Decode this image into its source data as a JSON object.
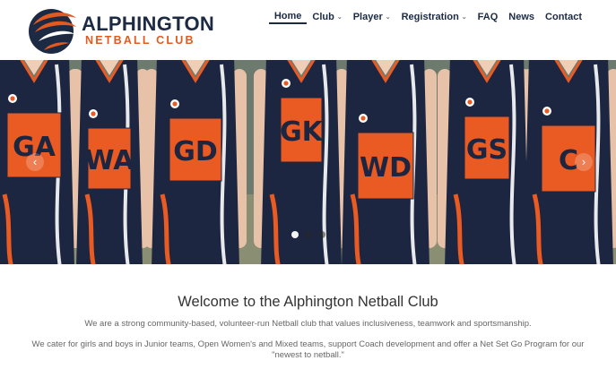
{
  "logo": {
    "line1": "ALPHINGTON",
    "line2": "NETBALL CLUB",
    "colors": {
      "navy": "#1d2a44",
      "orange": "#e35a20"
    }
  },
  "nav": {
    "items": [
      {
        "label": "Home",
        "active": true,
        "dropdown": false
      },
      {
        "label": "Club",
        "active": false,
        "dropdown": true
      },
      {
        "label": "Player",
        "active": false,
        "dropdown": true
      },
      {
        "label": "Registration",
        "active": false,
        "dropdown": true
      },
      {
        "label": "FAQ",
        "active": false,
        "dropdown": false
      },
      {
        "label": "News",
        "active": false,
        "dropdown": false
      },
      {
        "label": "Contact",
        "active": false,
        "dropdown": false
      }
    ]
  },
  "hero": {
    "bibs": [
      "GA",
      "WA",
      "GD",
      "GK",
      "WD",
      "GS",
      "C"
    ],
    "slides": 3,
    "active_slide": 1,
    "colors": {
      "dress": "#1c2640",
      "bib": "#ea5a23",
      "accent": "#ffffff"
    }
  },
  "welcome": {
    "heading": "Welcome to the Alphington Netball Club",
    "paragraph1": "We are a strong community-based, volunteer-run Netball club that values inclusiveness, teamwork and sportsmanship.",
    "paragraph2": "We cater for girls and boys in Junior teams, Open Women's and Mixed teams, support Coach development and offer a Net Set Go Program for our \"newest to netball.\""
  }
}
